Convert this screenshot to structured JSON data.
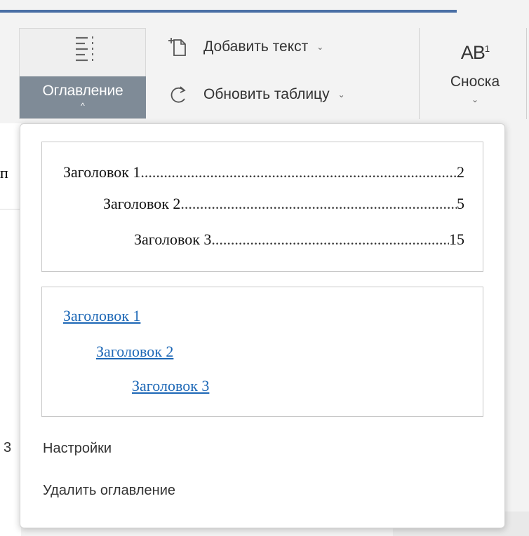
{
  "ribbon": {
    "toc_button": {
      "label": "Оглавление",
      "chevron": "^"
    },
    "add_text": {
      "label": "Добавить текст",
      "caret": "⌄"
    },
    "update_table": {
      "label": "Обновить таблицу",
      "caret": "⌄"
    },
    "footnote": {
      "icon_text": "AB",
      "icon_sup": "1",
      "label": "Сноска",
      "chevron": "⌄"
    }
  },
  "document": {
    "fragment_1": "п",
    "fragment_2": "3"
  },
  "popup": {
    "preview_plain": [
      {
        "title": "Заголовок 1",
        "page": "2"
      },
      {
        "title": "Заголовок 2",
        "page": "5"
      },
      {
        "title": "Заголовок 3",
        "page": "15"
      }
    ],
    "preview_links": [
      "Заголовок 1",
      "Заголовок 2",
      "Заголовок 3"
    ],
    "settings_label": "Настройки",
    "delete_label": "Удалить оглавление"
  },
  "colors": {
    "accent_line": "#4a6fa5",
    "toc_label_bg": "#7f8b97",
    "link": "#1c67b6"
  }
}
